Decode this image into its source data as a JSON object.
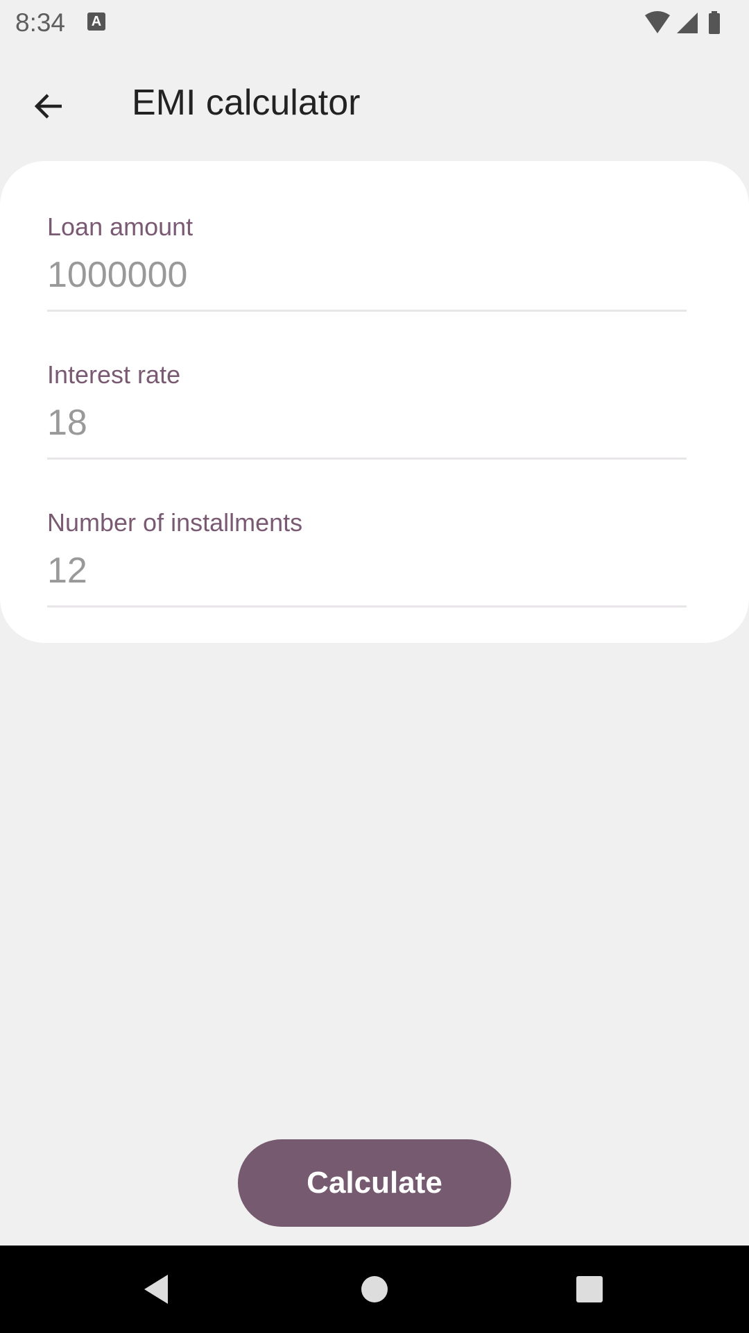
{
  "status_bar": {
    "time": "8:34",
    "notification_icon": "a-keyboard-icon",
    "wifi_icon": "wifi-icon",
    "signal_icon": "cell-signal-icon",
    "battery_icon": "battery-icon"
  },
  "app_bar": {
    "back_icon": "arrow-back-icon",
    "title": "EMI calculator"
  },
  "form": {
    "loan_amount": {
      "label": "Loan amount",
      "placeholder": "1000000"
    },
    "interest_rate": {
      "label": "Interest rate",
      "placeholder": "18"
    },
    "installments": {
      "label": "Number of installments",
      "placeholder": "12"
    }
  },
  "actions": {
    "calculate_label": "Calculate"
  },
  "nav_bar": {
    "back_icon": "nav-back-icon",
    "home_icon": "nav-home-icon",
    "recents_icon": "nav-recents-icon"
  },
  "colors": {
    "background": "#F1F0F1",
    "card": "#FFFFFF",
    "accent": "#765A6F",
    "label": "#7A5A72",
    "placeholder_text": "#999999"
  }
}
